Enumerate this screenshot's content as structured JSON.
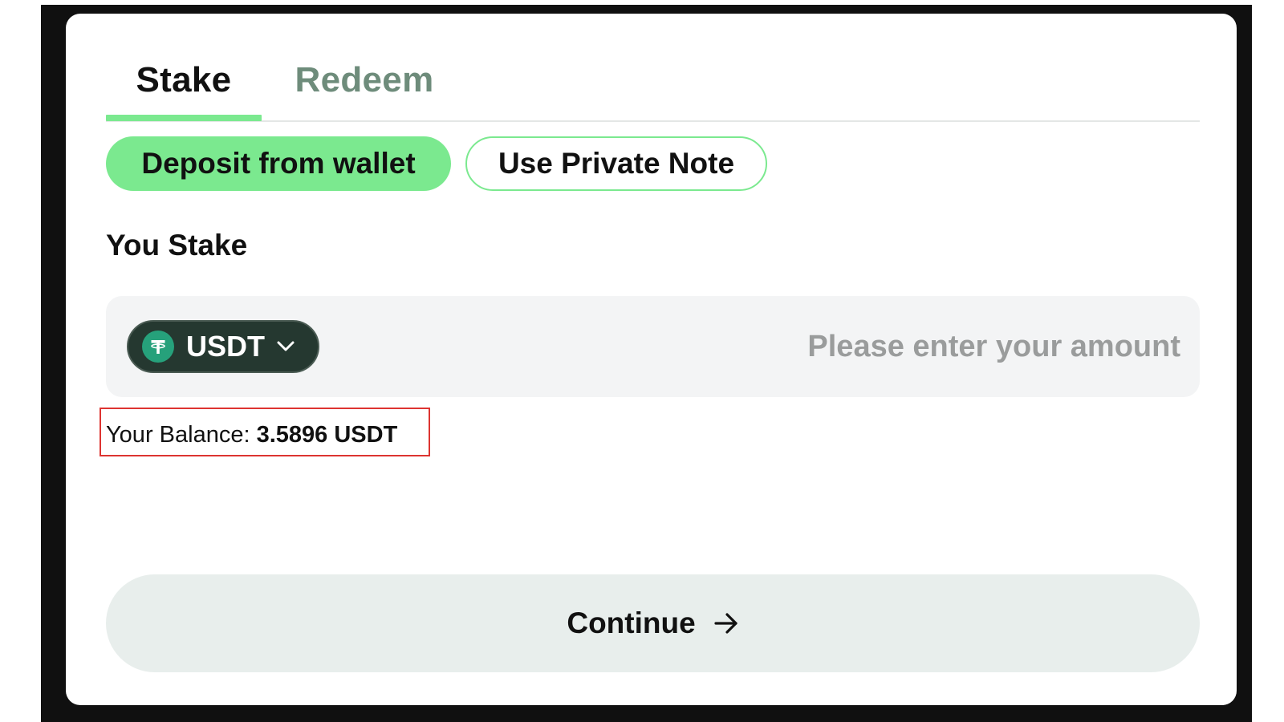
{
  "tabs": [
    {
      "label": "Stake",
      "active": true
    },
    {
      "label": "Redeem",
      "active": false
    }
  ],
  "source_options": [
    {
      "label": "Deposit from wallet",
      "selected": true
    },
    {
      "label": "Use Private Note",
      "selected": false
    }
  ],
  "stake": {
    "title": "You Stake",
    "token": {
      "symbol": "USDT",
      "icon": "tether-icon",
      "dropdown_icon": "chevron-down-icon"
    },
    "amount": {
      "value": "",
      "placeholder": "Please enter your amount"
    }
  },
  "balance": {
    "label": "Your Balance:",
    "value": "3.5896 USDT"
  },
  "continue_button": {
    "label": "Continue",
    "icon": "arrow-right-icon"
  },
  "colors": {
    "accent": "#7be98f",
    "token_select_bg": "#253830",
    "tether_green": "#26a17b",
    "highlight_border": "#dd3431",
    "inactive_tab": "#6e8c7b"
  }
}
